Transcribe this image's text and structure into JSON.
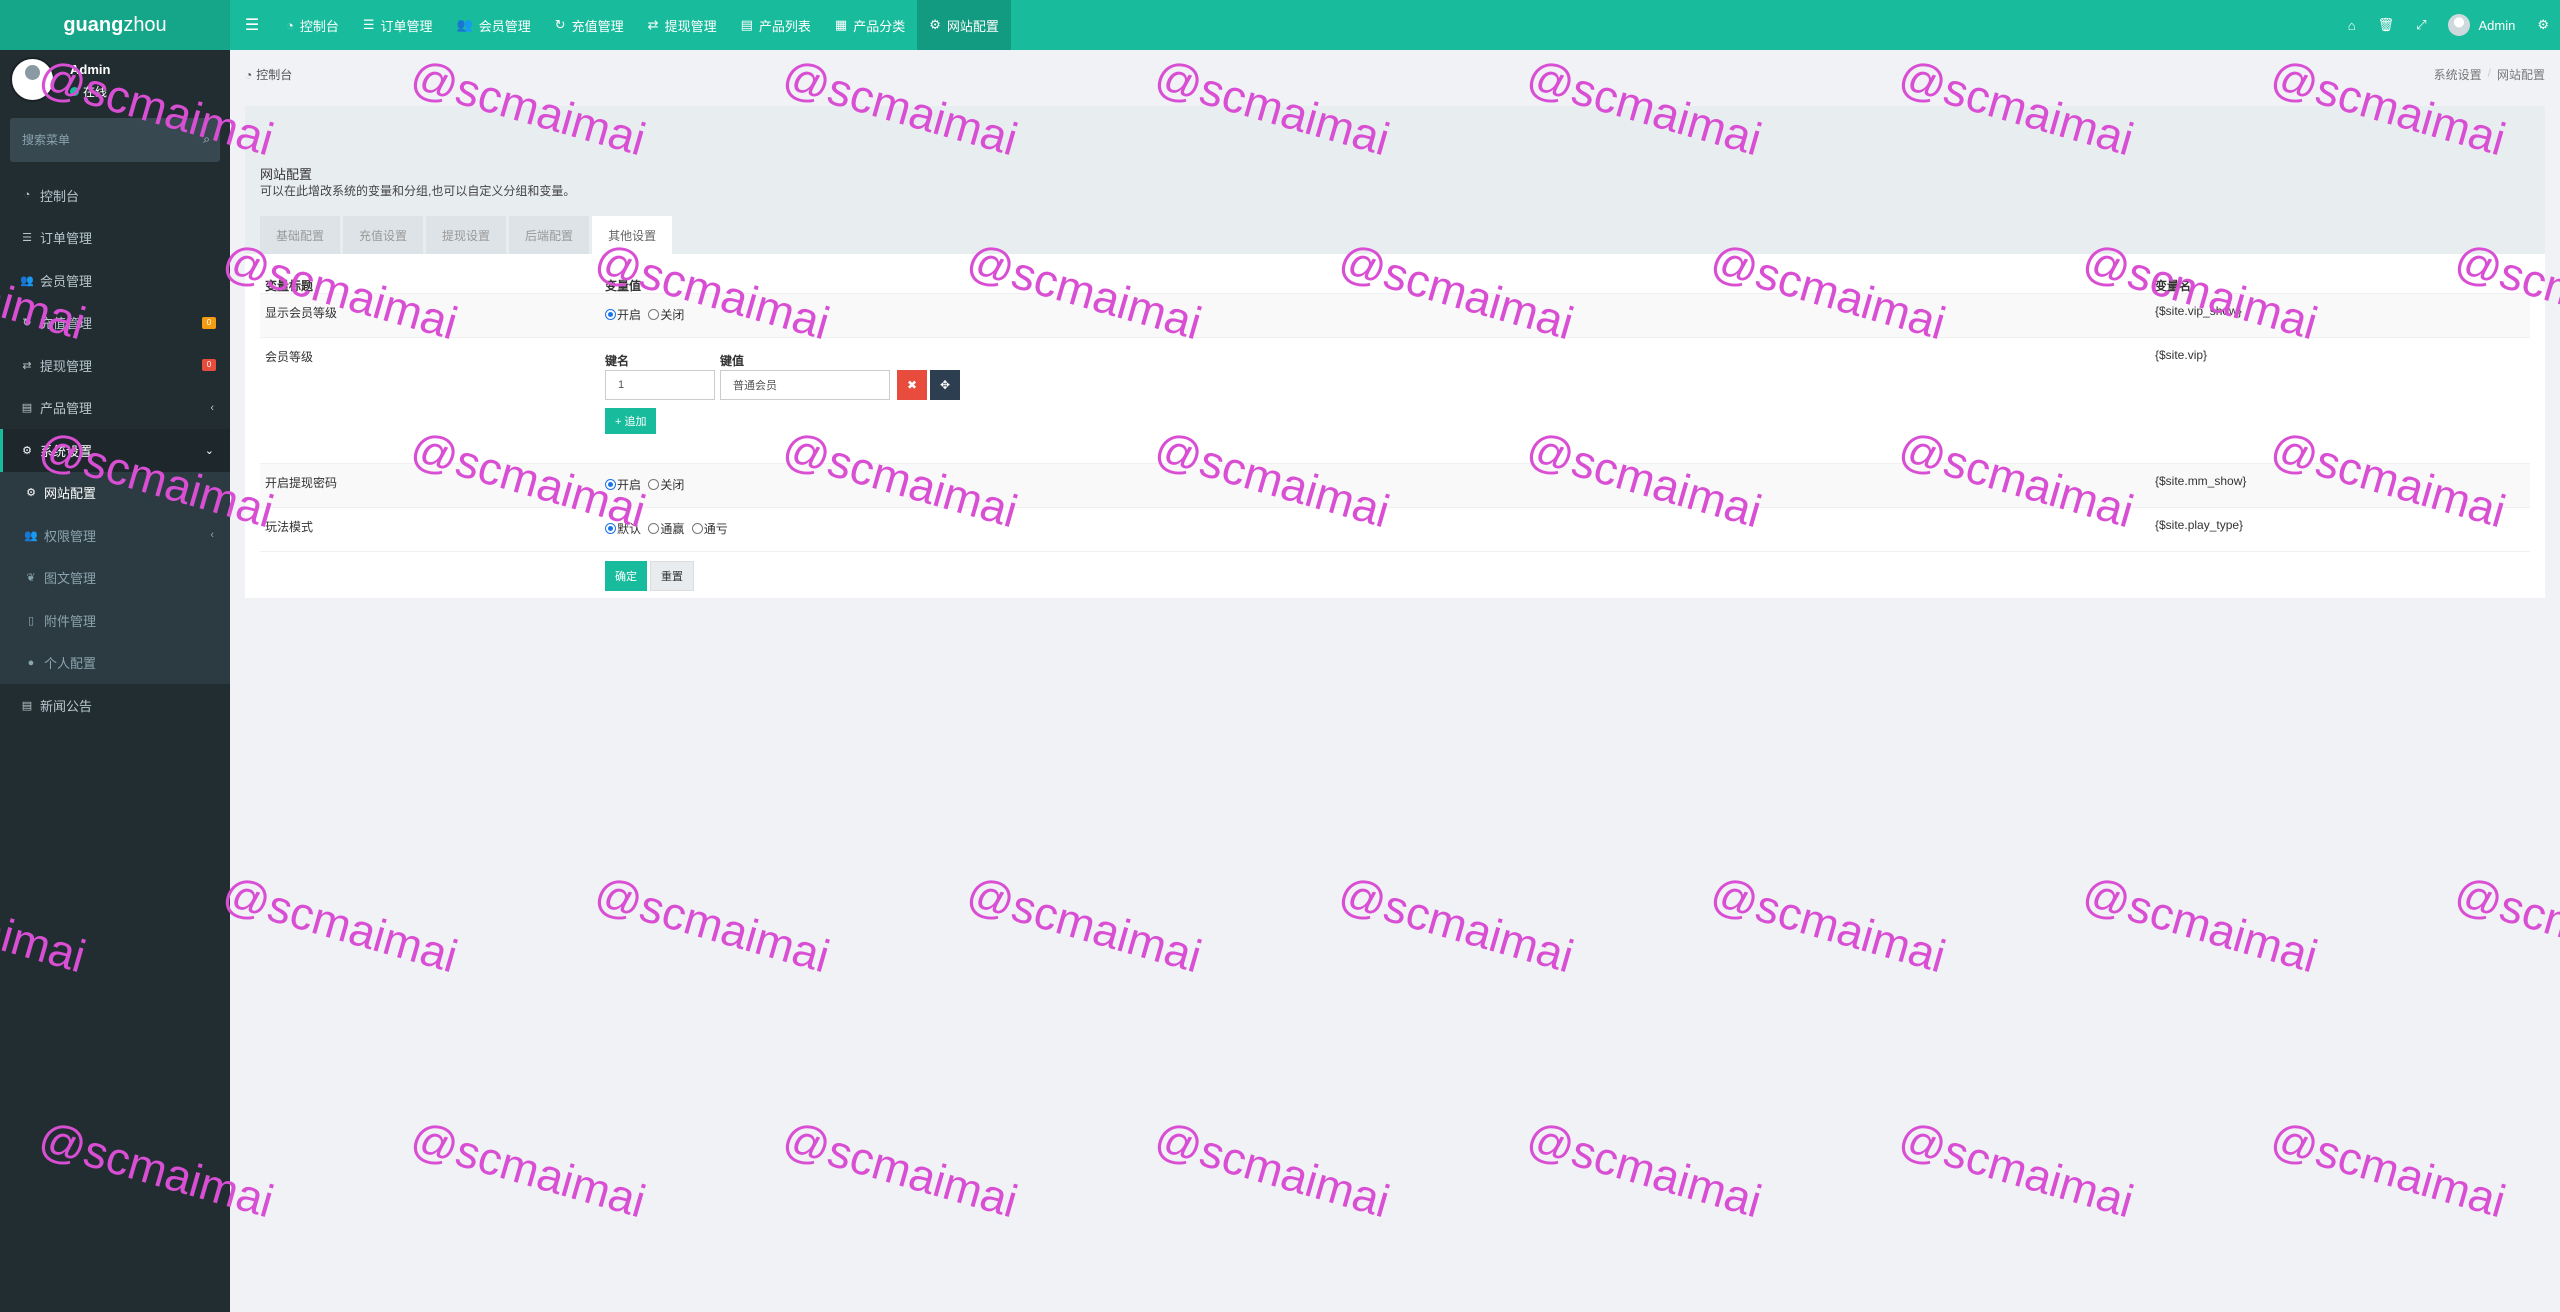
{
  "app": {
    "logo_bold": "guang",
    "logo_rest": "zhou"
  },
  "topnav": {
    "items": [
      {
        "label": "控制台",
        "icon": "dashboard-icon"
      },
      {
        "label": "订单管理",
        "icon": "list-icon"
      },
      {
        "label": "会员管理",
        "icon": "users-icon"
      },
      {
        "label": "充值管理",
        "icon": "recharge-icon"
      },
      {
        "label": "提现管理",
        "icon": "withdraw-icon"
      },
      {
        "label": "产品列表",
        "icon": "shop-icon"
      },
      {
        "label": "产品分类",
        "icon": "category-icon"
      },
      {
        "label": "网站配置",
        "icon": "gear-icon"
      }
    ],
    "active_index": 7,
    "user_name": "Admin"
  },
  "sidebar": {
    "user": {
      "name": "Admin",
      "status": "在线"
    },
    "search_placeholder": "搜索菜单",
    "items": [
      {
        "label": "控制台",
        "icon": "dashboard-icon"
      },
      {
        "label": "订单管理",
        "icon": "list-icon"
      },
      {
        "label": "会员管理",
        "icon": "users-icon"
      },
      {
        "label": "充值管理",
        "icon": "recharge-icon",
        "badge": "0"
      },
      {
        "label": "提现管理",
        "icon": "withdraw-icon",
        "badge": "0"
      },
      {
        "label": "产品管理",
        "icon": "shop-icon"
      },
      {
        "label": "系统设置",
        "icon": "cogs-icon"
      }
    ],
    "sub_items": [
      {
        "label": "网站配置",
        "icon": "gear-icon"
      },
      {
        "label": "权限管理",
        "icon": "group-icon"
      },
      {
        "label": "图文管理",
        "icon": "leaf-icon"
      },
      {
        "label": "附件管理",
        "icon": "file-icon"
      },
      {
        "label": "个人配置",
        "icon": "user-icon"
      }
    ],
    "last_item": {
      "label": "新闻公告",
      "icon": "news-icon"
    }
  },
  "breadcrumb": {
    "left": "控制台",
    "right": [
      "系统设置",
      "网站配置"
    ]
  },
  "panel": {
    "title": "网站配置",
    "description": "可以在此增改系统的变量和分组,也可以自定义分组和变量。",
    "tabs": [
      "基础配置",
      "充值设置",
      "提现设置",
      "后端配置",
      "其他设置"
    ],
    "active_tab": 4
  },
  "table": {
    "headers": [
      "变量标题",
      "变量值",
      "变量名"
    ],
    "rows": {
      "vip_show": {
        "title": "显示会员等级",
        "options": [
          "开启",
          "关闭"
        ],
        "selected": 0,
        "var": "{$site.vip_show}"
      },
      "vip": {
        "title": "会员等级",
        "key_label": "键名",
        "value_label": "键值",
        "key": "1",
        "value": "普通会员",
        "add_label": "追加",
        "var": "{$site.vip}"
      },
      "mm_show": {
        "title": "开启提现密码",
        "options": [
          "开启",
          "关闭"
        ],
        "selected": 0,
        "var": "{$site.mm_show}"
      },
      "play_type": {
        "title": "玩法模式",
        "options": [
          "默认",
          "通赢",
          "通亏"
        ],
        "selected": 0,
        "var": "{$site.play_type}"
      }
    },
    "submit_label": "确定",
    "reset_label": "重置"
  },
  "watermark": "@scmaimai"
}
